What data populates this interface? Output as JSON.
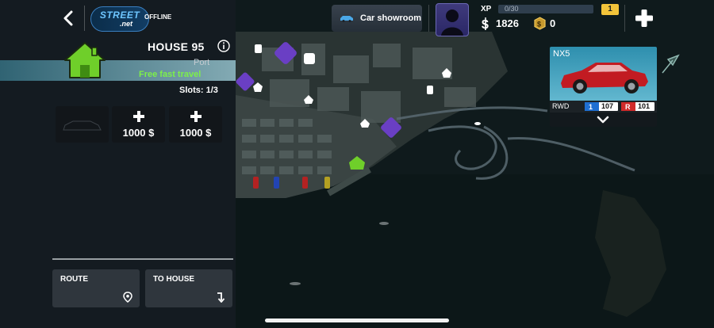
{
  "topbar": {
    "logo_top": "STREET",
    "logo_bottom": ".net",
    "status": "OFFLINE",
    "showroom_label": "Car showroom",
    "xp_label": "XP",
    "xp_progress": "0/30",
    "level": "1",
    "cash": "1826",
    "gold": "0"
  },
  "house": {
    "title": "HOUSE 95",
    "subtitle": "Port",
    "fast_travel": "Free fast travel",
    "slots_label": "Slots: 1/3",
    "slot_prices": [
      "1000",
      "1000"
    ]
  },
  "actions": {
    "route_label": "ROUTE",
    "to_house_label": "TO HOUSE"
  },
  "car": {
    "name": "NX5",
    "drive": "RWD",
    "stat_1": "107",
    "stat_2": "101"
  },
  "colors": {
    "accent_green": "#7df04a",
    "house_green": "#6fcf2a",
    "level_badge": "#f3c43a",
    "drift_purple": "#6a3fc4"
  },
  "icons": [
    "back-arrow-icon",
    "car-icon",
    "cash-icon",
    "gold-coin-icon",
    "plus-icon",
    "info-icon",
    "house-icon",
    "location-pin-icon",
    "turn-arrow-icon",
    "chevron-down-icon"
  ]
}
